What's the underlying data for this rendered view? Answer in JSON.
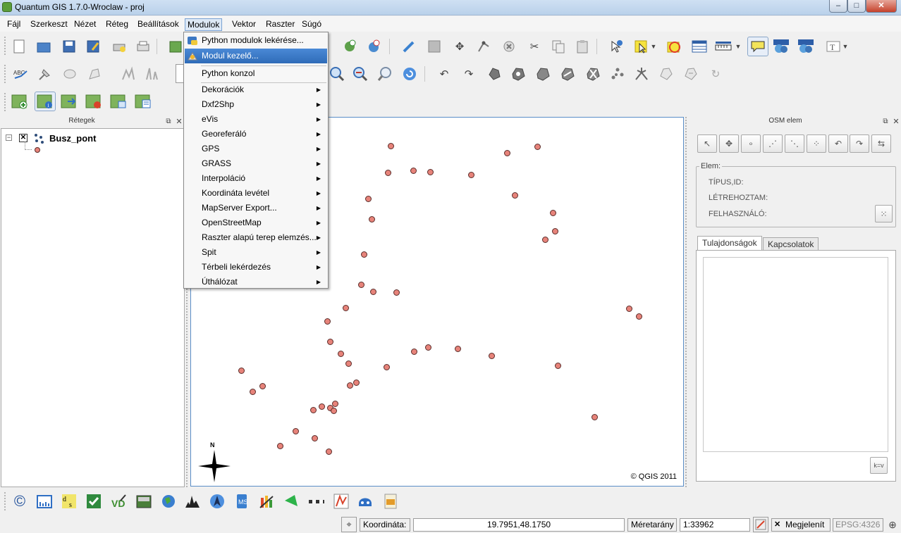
{
  "window": {
    "title": "Quantum GIS 1.7.0-Wroclaw - proj"
  },
  "menubar": {
    "items": [
      "Fájl",
      "Szerkeszt",
      "Nézet",
      "Réteg",
      "Beállítások",
      "Modulok",
      "Vektor",
      "Raszter",
      "Súgó"
    ]
  },
  "modulok_menu": {
    "items": [
      {
        "label": "Python modulok lekérése...",
        "submenu": false
      },
      {
        "label": "Modul kezelő...",
        "submenu": false,
        "highlighted": true
      },
      {
        "label": "Python konzol",
        "submenu": false
      },
      {
        "label": "Dekorációk",
        "submenu": true
      },
      {
        "label": "Dxf2Shp",
        "submenu": true
      },
      {
        "label": "eVis",
        "submenu": true
      },
      {
        "label": "Georeferáló",
        "submenu": true
      },
      {
        "label": "GPS",
        "submenu": true
      },
      {
        "label": "GRASS",
        "submenu": true
      },
      {
        "label": "Interpoláció",
        "submenu": true
      },
      {
        "label": "Koordináta levétel",
        "submenu": true
      },
      {
        "label": "MapServer Export...",
        "submenu": true
      },
      {
        "label": "OpenStreetMap",
        "submenu": true
      },
      {
        "label": "Raszter alapú terep elemzés...",
        "submenu": true
      },
      {
        "label": "Spit",
        "submenu": true
      },
      {
        "label": "Térbeli lekérdezés",
        "submenu": true
      },
      {
        "label": "Úthálózat",
        "submenu": true
      }
    ]
  },
  "layers_panel": {
    "title": "Rétegek",
    "layer_name": "Busz_pont"
  },
  "map": {
    "copyright": "© QGIS 2011",
    "north_label": "N",
    "point_color": "#e7837a"
  },
  "osm_panel": {
    "title": "OSM elem",
    "group_label": "Elem:",
    "fields": [
      "TÍPUS,ID:",
      "LÉTREHOZTAM:",
      "FELHASZNÁLÓ:"
    ],
    "tabs": [
      "Tulajdonságok",
      "Kapcsolatok"
    ]
  },
  "statusbar": {
    "coord_label": "Koordináta:",
    "coord_value": "19.7951,48.1750",
    "scale_label": "Méretarány",
    "scale_value": "1:33962",
    "render_label": "Megjelenít",
    "crs": "EPSG:4326"
  }
}
